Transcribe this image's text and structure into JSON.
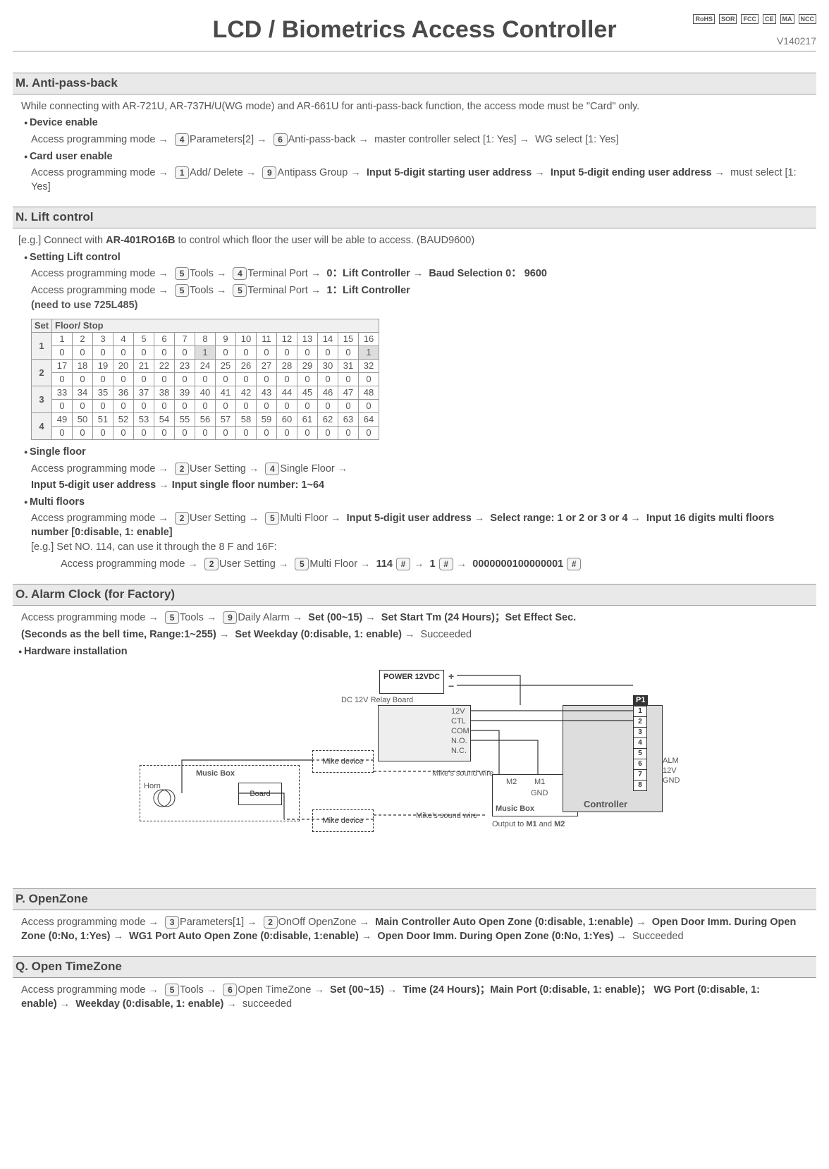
{
  "header": {
    "title": "LCD / Biometrics Access Controller",
    "version": "V140217",
    "certs": [
      "RoHS",
      "SOR",
      "FCC",
      "CE",
      "MA",
      "NCC"
    ]
  },
  "M": {
    "title": "M. Anti-pass-back",
    "intro": "While connecting with AR-721U, AR-737H/U(WG mode) and AR-661U for anti-pass-back function, the access mode must be \"Card\" only.",
    "b1": "Device enable",
    "s1_a": "Access programming mode",
    "s1_b": "Parameters[2]",
    "s1_c": "Anti-pass-back",
    "s1_d": "master controller select [1: Yes]",
    "s1_e": "WG select [1: Yes]",
    "b2": "Card user enable",
    "s2_a": "Access programming mode",
    "s2_b": "Add/ Delete",
    "s2_c": "Antipass Group",
    "s2_d": "Input 5-digit starting user address",
    "s2_e": "Input 5-digit ending user address",
    "s2_f": "must select [1: Yes]"
  },
  "N": {
    "title": "N. Lift control",
    "intro_a": "[e.g.] Connect with ",
    "intro_b": "AR-401RO16B",
    "intro_c": " to control which floor the user will be able to access. (BAUD9600)",
    "b1": "Setting Lift control",
    "s1_a": "Access programming mode",
    "s1_b": "Tools",
    "s1_c": "Terminal Port",
    "s1_d": "0：Lift Controller",
    "s1_e": "Baud Selection 0： 9600",
    "s2_a": "Access programming mode",
    "s2_b": "Tools",
    "s2_c": "Terminal Port",
    "s2_d": "1：Lift Controller",
    "need": "(need to use 725L485)",
    "th_set": "Set",
    "th_fs": "Floor/ Stop",
    "table": [
      {
        "set": "1",
        "floors": [
          "1",
          "2",
          "3",
          "4",
          "5",
          "6",
          "7",
          "8",
          "9",
          "10",
          "11",
          "12",
          "13",
          "14",
          "15",
          "16"
        ],
        "vals": [
          "0",
          "0",
          "0",
          "0",
          "0",
          "0",
          "0",
          "1",
          "0",
          "0",
          "0",
          "0",
          "0",
          "0",
          "0",
          "1"
        ],
        "sel": [
          7,
          15
        ]
      },
      {
        "set": "2",
        "floors": [
          "17",
          "18",
          "19",
          "20",
          "21",
          "22",
          "23",
          "24",
          "25",
          "26",
          "27",
          "28",
          "29",
          "30",
          "31",
          "32"
        ],
        "vals": [
          "0",
          "0",
          "0",
          "0",
          "0",
          "0",
          "0",
          "0",
          "0",
          "0",
          "0",
          "0",
          "0",
          "0",
          "0",
          "0"
        ],
        "sel": []
      },
      {
        "set": "3",
        "floors": [
          "33",
          "34",
          "35",
          "36",
          "37",
          "38",
          "39",
          "40",
          "41",
          "42",
          "43",
          "44",
          "45",
          "46",
          "47",
          "48"
        ],
        "vals": [
          "0",
          "0",
          "0",
          "0",
          "0",
          "0",
          "0",
          "0",
          "0",
          "0",
          "0",
          "0",
          "0",
          "0",
          "0",
          "0"
        ],
        "sel": []
      },
      {
        "set": "4",
        "floors": [
          "49",
          "50",
          "51",
          "52",
          "53",
          "54",
          "55",
          "56",
          "57",
          "58",
          "59",
          "60",
          "61",
          "62",
          "63",
          "64"
        ],
        "vals": [
          "0",
          "0",
          "0",
          "0",
          "0",
          "0",
          "0",
          "0",
          "0",
          "0",
          "0",
          "0",
          "0",
          "0",
          "0",
          "0"
        ],
        "sel": []
      }
    ],
    "b2": "Single floor",
    "s3_a": "Access programming mode",
    "s3_b": "User Setting",
    "s3_c": "Single Floor",
    "s3_d": "Input 5-digit user address",
    "s3_e": "Input single floor number: 1~64",
    "b3": "Multi floors",
    "s4_a": "Access programming mode",
    "s4_b": "User Setting",
    "s4_c": "Multi Floor",
    "s4_d": "Input 5-digit user address",
    "s4_e": "Select range: 1 or 2 or 3 or 4",
    "s4_f": "Input 16 digits multi floors number [0:disable, 1: enable]",
    "eg": "[e.g.] Set NO. 114, can use it through the 8 F and 16F:",
    "s5_a": "Access programming mode",
    "s5_b": "User Setting",
    "s5_c": "Multi Floor",
    "s5_d": "114",
    "s5_e": "1",
    "s5_f": "0000000100000001",
    "hash": "#"
  },
  "O": {
    "title": "O. Alarm Clock (for Factory)",
    "s1_a": "Access programming mode",
    "s1_b": "Tools",
    "s1_c": "Daily Alarm",
    "s1_d": "Set (00~15)",
    "s1_e": "Set Start Tm (24 Hours)；Set Effect Sec.",
    "s1_f": "(Seconds as the bell time, Range:1~255)",
    "s1_g": "Set Weekday (0:disable, 1: enable)",
    "s1_h": "Succeeded",
    "b1": "Hardware installation",
    "diag": {
      "power": "POWER 12VDC",
      "plus": "+",
      "minus": "−",
      "relay": "DC 12V Relay Board",
      "r12v": "12V",
      "rctl": "CTL",
      "rcom": "COM",
      "rno": "N.O.",
      "rnc": "N.C.",
      "mike": "Mike device",
      "mbox_l": "Music Box",
      "board": "Board",
      "horn": "Horn",
      "mwire": "Mike's sound wire",
      "mbox_r": "Music Box",
      "m1": "M1",
      "m2": "M2",
      "gnd": "GND",
      "out": "Output to M1 and M2",
      "ctrl": "Controller",
      "p1": "P1",
      "pins": [
        "1",
        "2",
        "3",
        "4",
        "5",
        "6",
        "7",
        "8"
      ],
      "alm": "ALM",
      "p12v": "12V",
      "pgnd": "GND"
    }
  },
  "P": {
    "title": "P. OpenZone",
    "s1_a": "Access programming mode",
    "s1_b": "Parameters[1]",
    "s1_c": "OnOff OpenZone",
    "s1_d": "Main Controller Auto Open Zone (0:disable, 1:enable)",
    "s1_e": "Open Door Imm. During Open Zone (0:No, 1:Yes)",
    "s1_f": "WG1 Port Auto Open Zone (0:disable, 1:enable)",
    "s1_g": "Open Door Imm. During Open Zone (0:No, 1:Yes)",
    "s1_h": "Succeeded"
  },
  "Q": {
    "title": "Q. Open TimeZone",
    "s1_a": "Access programming mode",
    "s1_b": "Tools",
    "s1_c": "Open TimeZone",
    "s1_d": "Set (00~15)",
    "s1_e": "Time (24 Hours)；Main Port (0:disable, 1: enable)；",
    "s1_f": "WG Port (0:disable, 1: enable)",
    "s1_g": "Weekday (0:disable, 1: enable)",
    "s1_h": "succeeded"
  },
  "k": {
    "k1": "1",
    "k2": "2",
    "k3": "3",
    "k4": "4",
    "k5": "5",
    "k6": "6",
    "k9": "9"
  }
}
